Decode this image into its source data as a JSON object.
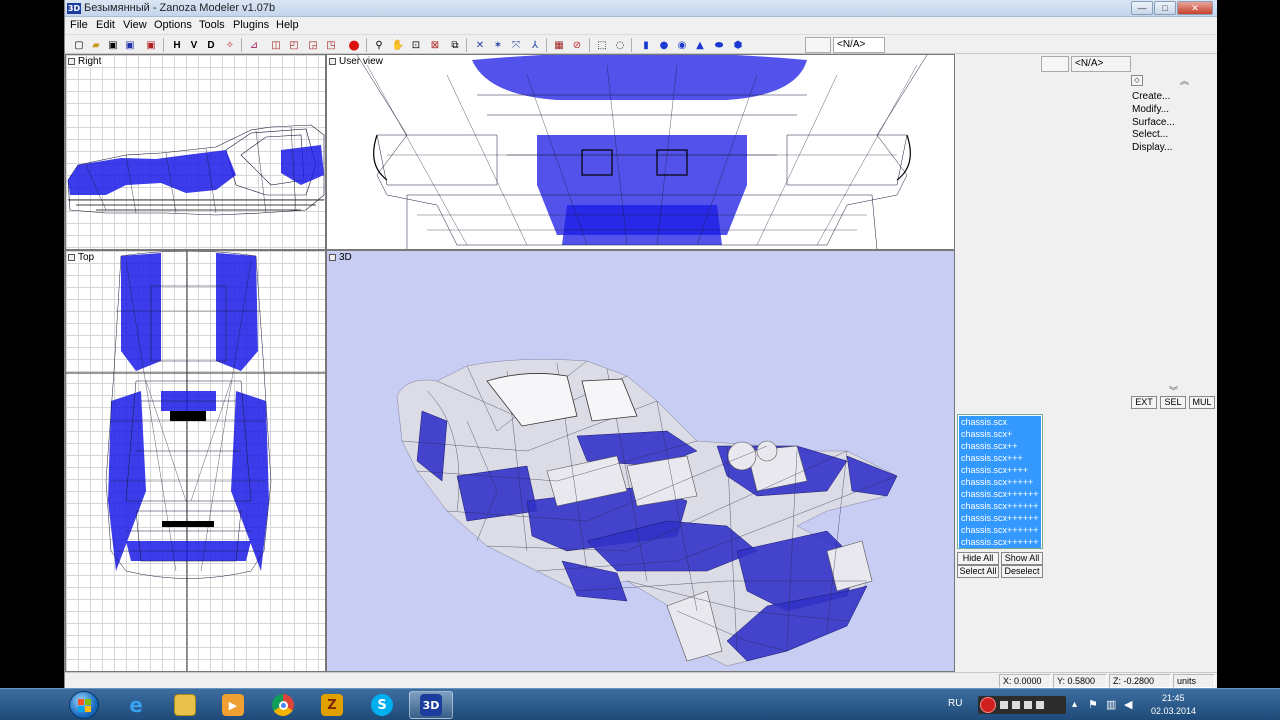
{
  "window": {
    "title": "Безымянный - Zanoza Modeler v1.07b",
    "logo_text": "3D",
    "minimize": "—",
    "maximize": "□",
    "close": "✕"
  },
  "menu": [
    "File",
    "Edit",
    "View",
    "Options",
    "Tools",
    "Plugins",
    "Help"
  ],
  "toolbar": {
    "letters": [
      "H",
      "V",
      "D"
    ],
    "na_label": "<N/A>"
  },
  "viewports": {
    "right": "Right",
    "user": "User view",
    "top": "Top",
    "three_d": "3D"
  },
  "panel": {
    "na_label": "<N/A>",
    "nav_items": [
      "Create...",
      "Modify...",
      "Surface...",
      "Select...",
      "Display..."
    ],
    "mode_buttons": [
      "EXT",
      "SEL",
      "MUL"
    ],
    "objects": [
      "chassis.scx",
      "chassis.scx+",
      "chassis.scx++",
      "chassis.scx+++",
      "chassis.scx++++",
      "chassis.scx+++++",
      "chassis.scx++++++",
      "chassis.scx++++++",
      "chassis.scx++++++",
      "chassis.scx++++++",
      "chassis.scx++++++"
    ],
    "hide_all": "Hide All",
    "show_all": "Show All",
    "select_all": "Select All",
    "deselect": "Deselect"
  },
  "status": {
    "x": "X: 0.0000",
    "y": "Y: 0.5800",
    "z": "Z: -0.2800",
    "units": "units"
  },
  "taskbar": {
    "apps": [
      "ie",
      "explorer",
      "media",
      "chrome",
      "zanoza",
      "skype",
      "3d"
    ],
    "app_3d_label": "3D",
    "app_z_label": "Z",
    "app_skype_label": "S",
    "language": "RU",
    "time": "21:45",
    "date": "02.03.2014"
  },
  "colors": {
    "wire_dark": "#1a1a3a",
    "wire_blue": "#1a1ae6",
    "viewport_3d_bg": "#c8cdf3",
    "selection": "#3399ff"
  }
}
